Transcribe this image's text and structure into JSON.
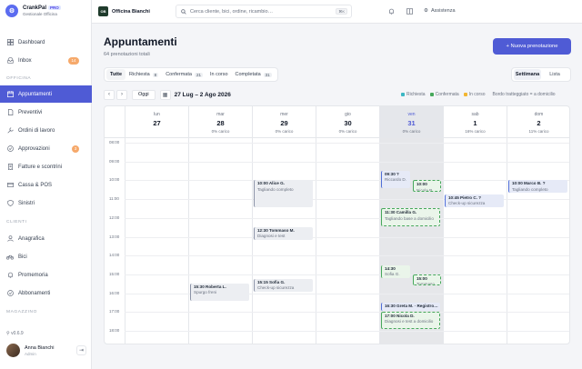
{
  "brand": {
    "name": "CrankPal",
    "badge": "PRO",
    "subtitle": "Gestionale Officina"
  },
  "sidebar": {
    "items_top": [
      {
        "label": "Dashboard",
        "icon": "dashboard-icon"
      },
      {
        "label": "Inbox",
        "icon": "inbox-icon",
        "badge": "14"
      }
    ],
    "section_officina": "OFFICINA",
    "items_officina": [
      {
        "label": "Appuntamenti",
        "icon": "calendar-icon",
        "active": true
      },
      {
        "label": "Preventivi",
        "icon": "document-icon"
      },
      {
        "label": "Ordini di lavoro",
        "icon": "wrench-icon"
      },
      {
        "label": "Approvazioni",
        "icon": "check-circle-icon",
        "badge": "3"
      },
      {
        "label": "Fatture e scontrini",
        "icon": "receipt-icon"
      },
      {
        "label": "Cassa & POS",
        "icon": "card-icon"
      },
      {
        "label": "Sinistri",
        "icon": "shield-icon"
      }
    ],
    "section_clienti": "CLIENTI",
    "items_clienti": [
      {
        "label": "Anagrafica",
        "icon": "user-icon"
      },
      {
        "label": "Bici",
        "icon": "bike-icon"
      },
      {
        "label": "Promemoria",
        "icon": "bell-icon"
      },
      {
        "label": "Abbonamenti",
        "icon": "check-icon"
      }
    ],
    "section_magazzino": "MAGAZZINO",
    "version": "v0.6.9",
    "user": {
      "name": "Anna Bianchi",
      "role": "Admin"
    }
  },
  "topbar": {
    "shop_logo": "OB",
    "shop_name": "Officina Bianchi",
    "search_placeholder": "Cerca cliente, bici, ordine, ricambio…",
    "search_shortcut": "⌘K",
    "assist_label": "Assistenza"
  },
  "page": {
    "title": "Appuntamenti",
    "subtitle": "64 prenotazioni totali",
    "new_button": "+ Nuova prenotazione"
  },
  "filters": [
    {
      "label": "Tutte",
      "active": true
    },
    {
      "label": "Richiesta",
      "count": "8"
    },
    {
      "label": "Confermata",
      "count": "21"
    },
    {
      "label": "In corso"
    },
    {
      "label": "Completata",
      "count": "31"
    }
  ],
  "views": [
    {
      "label": "Settimana",
      "active": true
    },
    {
      "label": "Lista"
    }
  ],
  "calendar_nav": {
    "prev": "‹",
    "next": "›",
    "today": "Oggi",
    "range": "27 Lug – 2 Ago 2026"
  },
  "legend": [
    {
      "label": "Richiesta",
      "color": "#3cb7c4"
    },
    {
      "label": "Confermata",
      "color": "#47a85c"
    },
    {
      "label": "In corso",
      "color": "#f2b632"
    },
    {
      "label": "Bordo tratteggiato = a domicilio",
      "color": ""
    }
  ],
  "days": [
    {
      "name": "lun",
      "num": "27",
      "load": ""
    },
    {
      "name": "mar",
      "num": "28",
      "load": "0% carico"
    },
    {
      "name": "mer",
      "num": "29",
      "load": "0% carico"
    },
    {
      "name": "gio",
      "num": "30",
      "load": "0% carico"
    },
    {
      "name": "ven",
      "num": "31",
      "load": "0% carico",
      "today": true
    },
    {
      "name": "sab",
      "num": "1",
      "load": "16% carico"
    },
    {
      "name": "dom",
      "num": "2",
      "load": "11% carico"
    }
  ],
  "hours": [
    "08:00",
    "09:00",
    "10:00",
    "11:00",
    "12:00",
    "13:00",
    "14:00",
    "15:00",
    "16:00",
    "17:00",
    "18:00"
  ],
  "events": [
    {
      "day": 2,
      "start": "10:00",
      "end": "11:30",
      "title": "10:00 Alice G.",
      "sub": "Tagliando completo",
      "style": "grey"
    },
    {
      "day": 2,
      "start": "12:30",
      "end": "13:15",
      "title": "12:30 Tommaso M.",
      "sub": "Diagnosi e test",
      "style": "grey"
    },
    {
      "day": 2,
      "start": "15:15",
      "end": "16:00",
      "title": "15:15 Sofia G.",
      "sub": "Check-up sicurezza",
      "style": "grey"
    },
    {
      "day": 1,
      "start": "15:30",
      "end": "16:30",
      "title": "15:30 Roberta L.",
      "sub": "Spurgo freni",
      "style": "grey"
    },
    {
      "day": 4,
      "start": "09:30",
      "end": "10:30",
      "title": "09:30 ?",
      "sub": "Riccardo D.",
      "style": "blue",
      "half": 0
    },
    {
      "day": 4,
      "start": "10:00",
      "end": "10:40",
      "title": "10:00",
      "sub": "Nicola R.",
      "style": "green",
      "half": 1
    },
    {
      "day": 4,
      "start": "11:30",
      "end": "12:30",
      "title": "11:30 Camilla G.",
      "sub": "Tagliando base a domicilio",
      "style": "green"
    },
    {
      "day": 4,
      "start": "14:30",
      "end": "15:15",
      "title": "14:30",
      "sub": "Sofia G.",
      "style": "greensolid",
      "half": 0
    },
    {
      "day": 4,
      "start": "15:00",
      "end": "15:40",
      "title": "15:00",
      "sub": "Tommaso…",
      "style": "green",
      "half": 1
    },
    {
      "day": 4,
      "start": "16:30",
      "end": "17:00",
      "title": "16:30 Greta M. · Registro…",
      "sub": "",
      "style": "blue"
    },
    {
      "day": 4,
      "start": "17:00",
      "end": "18:00",
      "title": "17:00 Nicola D.",
      "sub": "Diagnosi e test a domicilio",
      "style": "green"
    },
    {
      "day": 5,
      "start": "10:45",
      "end": "11:30",
      "title": "10:45 Pietro C. ?",
      "sub": "Check-up sicurezza",
      "style": "blue"
    },
    {
      "day": 6,
      "start": "10:00",
      "end": "10:45",
      "title": "10:00 Marco B. ?",
      "sub": "Tagliando completo",
      "style": "blue"
    }
  ]
}
